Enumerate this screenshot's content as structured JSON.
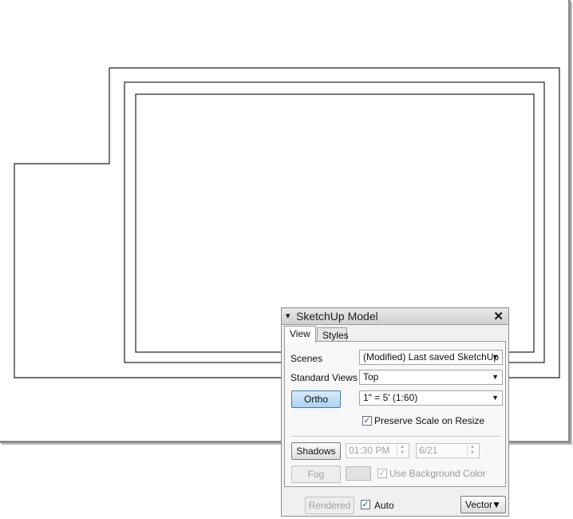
{
  "panel": {
    "title": "SketchUp Model",
    "close_glyph": "✕",
    "collapse_glyph": "▾",
    "tabs": [
      {
        "label": "View",
        "active": true
      },
      {
        "label": "Styles",
        "active": false
      }
    ],
    "scenes": {
      "label": "Scenes",
      "value": "(Modified) Last saved SketchUp Vi"
    },
    "standard_views": {
      "label": "Standard Views",
      "value": "Top"
    },
    "ortho": {
      "label": "Ortho",
      "pressed": true
    },
    "scale": {
      "value": "1\" = 5' (1:60)"
    },
    "preserve_scale": {
      "label": "Preserve Scale on Resize",
      "checked": true
    },
    "shadows": {
      "label": "Shadows",
      "time": "01:30 PM",
      "date": "6/21"
    },
    "fog": {
      "label": "Fog",
      "use_bg_label": "Use Background Color",
      "use_bg_checked": true
    },
    "footer": {
      "rendered_label": "Rendered",
      "auto_label": "Auto",
      "auto_checked": true,
      "vector_label": "Vector"
    }
  },
  "colors": {
    "accent_button": "#a9d2f3",
    "check_mark": "#1c5aa3"
  },
  "icons": {
    "collapse": "triangle-down-icon",
    "close": "close-icon",
    "dropdown": "chevron-down-icon",
    "checkbox": "checkmark-icon"
  }
}
